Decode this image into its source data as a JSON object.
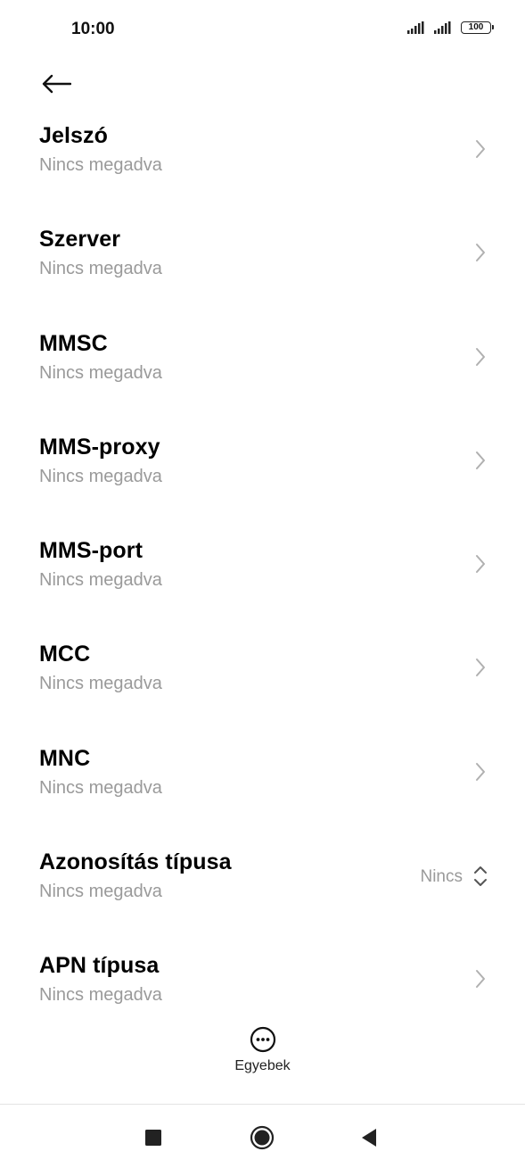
{
  "status_bar": {
    "time": "10:00",
    "battery": "100",
    "icons": [
      "signal-icon",
      "signal-icon",
      "battery-icon"
    ]
  },
  "header": {
    "back_icon": "arrow-left-icon"
  },
  "rows": [
    {
      "title": "Jelszó",
      "subtitle": "Nincs megadva"
    },
    {
      "title": "Szerver",
      "subtitle": "Nincs megadva"
    },
    {
      "title": "MMSC",
      "subtitle": "Nincs megadva"
    },
    {
      "title": "MMS-proxy",
      "subtitle": "Nincs megadva"
    },
    {
      "title": "MMS-port",
      "subtitle": "Nincs megadva"
    },
    {
      "title": "MCC",
      "subtitle": "Nincs megadva"
    },
    {
      "title": "MNC",
      "subtitle": "Nincs megadva"
    },
    {
      "title": "Azonosítás típusa",
      "subtitle": "Nincs megadva",
      "value": "Nincs"
    },
    {
      "title": "APN típusa",
      "subtitle": "Nincs megadva"
    }
  ],
  "more": {
    "label": "Egyebek",
    "icon": "more-horizontal-icon"
  },
  "nav": {
    "icons": [
      "recent-apps-icon",
      "home-icon",
      "back-icon"
    ]
  },
  "colors": {
    "background": "#ffffff",
    "title": "#000000",
    "subtitle": "#9a9a9a",
    "chevron": "#b0b0b0"
  }
}
